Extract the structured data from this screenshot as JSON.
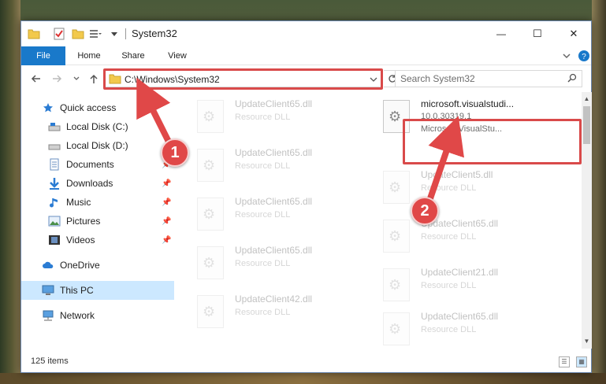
{
  "window": {
    "title": "System32",
    "controls": {
      "minimize": "—",
      "maximize": "☐",
      "close": "✕"
    }
  },
  "ribbon": {
    "tabs": [
      {
        "label": "File"
      },
      {
        "label": "Home"
      },
      {
        "label": "Share"
      },
      {
        "label": "View"
      }
    ]
  },
  "address": {
    "path": "C:\\Windows\\System32",
    "search_placeholder": "Search System32"
  },
  "nav": {
    "items": [
      {
        "label": "Quick access",
        "icon": "star-icon"
      },
      {
        "label": "Local Disk (C:)",
        "icon": "drive-icon"
      },
      {
        "label": "Local Disk (D:)",
        "icon": "drive-icon"
      },
      {
        "label": "Documents",
        "icon": "documents-icon"
      },
      {
        "label": "Downloads",
        "icon": "download-icon"
      },
      {
        "label": "Music",
        "icon": "music-icon"
      },
      {
        "label": "Pictures",
        "icon": "pictures-icon"
      },
      {
        "label": "Videos",
        "icon": "videos-icon"
      },
      {
        "label": "OneDrive",
        "icon": "cloud-icon"
      },
      {
        "label": "This PC",
        "icon": "computer-icon"
      },
      {
        "label": "Network",
        "icon": "network-icon"
      }
    ]
  },
  "files": {
    "left": [
      {
        "name": "UpdateClient65.dll",
        "type": "Resource DLL"
      },
      {
        "name": "UpdateClient65.dll",
        "type": "Resource DLL"
      },
      {
        "name": "UpdateClient65.dll",
        "type": "Resource DLL"
      },
      {
        "name": "UpdateClient65.dll",
        "type": "Resource DLL"
      },
      {
        "name": "UpdateClient42.dll",
        "type": "Resource DLL"
      }
    ],
    "right": [
      {
        "name": "UpdateClient5.dll",
        "type": "Resource DLL"
      },
      {
        "name": "UpdateClient65.dll",
        "type": "Resource DLL"
      },
      {
        "name": "UpdateClient21.dll",
        "type": "Resource DLL"
      },
      {
        "name": "UpdateClient65.dll",
        "type": "Resource DLL"
      }
    ],
    "selected": {
      "name": "microsoft.visualstudi...",
      "version": "10.0.30319.1",
      "company": "Microsoft.VisualStu..."
    }
  },
  "status": {
    "count": "125 items"
  },
  "callouts": [
    {
      "label": "1"
    },
    {
      "label": "2"
    }
  ],
  "colors": {
    "accent": "#1979ca",
    "callout": "#e04848",
    "selection": "#cce8ff"
  }
}
